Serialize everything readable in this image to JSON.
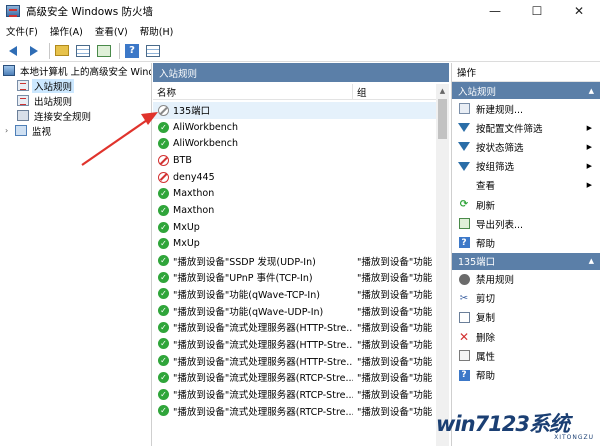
{
  "window": {
    "title": "高级安全 Windows 防火墙",
    "minimize": "—",
    "maximize": "☐",
    "close": "✕"
  },
  "menu": [
    "文件(F)",
    "操作(A)",
    "查看(V)",
    "帮助(H)"
  ],
  "tree": {
    "root": "本地计算机 上的高级安全 Windows",
    "items": [
      "入站规则",
      "出站规则",
      "连接安全规则",
      "监视"
    ]
  },
  "main": {
    "header": "入站规则",
    "columns": {
      "name": "名称",
      "group": "组"
    },
    "rows": [
      {
        "status": "off",
        "name": "135端口",
        "group": ""
      },
      {
        "status": "ok",
        "name": "AliWorkbench",
        "group": ""
      },
      {
        "status": "ok",
        "name": "AliWorkbench",
        "group": ""
      },
      {
        "status": "block",
        "name": "BTB",
        "group": ""
      },
      {
        "status": "block",
        "name": "deny445",
        "group": ""
      },
      {
        "status": "ok",
        "name": "Maxthon",
        "group": ""
      },
      {
        "status": "ok",
        "name": "Maxthon",
        "group": ""
      },
      {
        "status": "ok",
        "name": "MxUp",
        "group": ""
      },
      {
        "status": "ok",
        "name": "MxUp",
        "group": ""
      },
      {
        "status": "ok",
        "name": "\"播放到设备\"SSDP 发现(UDP-In)",
        "group": "\"播放到设备\"功能"
      },
      {
        "status": "ok",
        "name": "\"播放到设备\"UPnP 事件(TCP-In)",
        "group": "\"播放到设备\"功能"
      },
      {
        "status": "ok",
        "name": "\"播放到设备\"功能(qWave-TCP-In)",
        "group": "\"播放到设备\"功能"
      },
      {
        "status": "ok",
        "name": "\"播放到设备\"功能(qWave-UDP-In)",
        "group": "\"播放到设备\"功能"
      },
      {
        "status": "ok",
        "name": "\"播放到设备\"流式处理服务器(HTTP-Stre...",
        "group": "\"播放到设备\"功能"
      },
      {
        "status": "ok",
        "name": "\"播放到设备\"流式处理服务器(HTTP-Stre...",
        "group": "\"播放到设备\"功能"
      },
      {
        "status": "ok",
        "name": "\"播放到设备\"流式处理服务器(HTTP-Stre...",
        "group": "\"播放到设备\"功能"
      },
      {
        "status": "ok",
        "name": "\"播放到设备\"流式处理服务器(RTCP-Stre...",
        "group": "\"播放到设备\"功能"
      },
      {
        "status": "ok",
        "name": "\"播放到设备\"流式处理服务器(RTCP-Stre...",
        "group": "\"播放到设备\"功能"
      },
      {
        "status": "ok",
        "name": "\"播放到设备\"流式处理服务器(RTCP-Stre...",
        "group": "\"播放到设备\"功能"
      }
    ]
  },
  "actions": {
    "title": "操作",
    "section1": "入站规则",
    "items1": [
      "新建规则...",
      "按配置文件筛选",
      "按状态筛选",
      "按组筛选",
      "查看",
      "刷新",
      "导出列表...",
      "帮助"
    ],
    "section2": "135端口",
    "items2": [
      "禁用规则",
      "剪切",
      "复制",
      "删除",
      "属性",
      "帮助"
    ]
  },
  "watermark": {
    "main": "win7123系统",
    "sub": "XITONGZU"
  }
}
